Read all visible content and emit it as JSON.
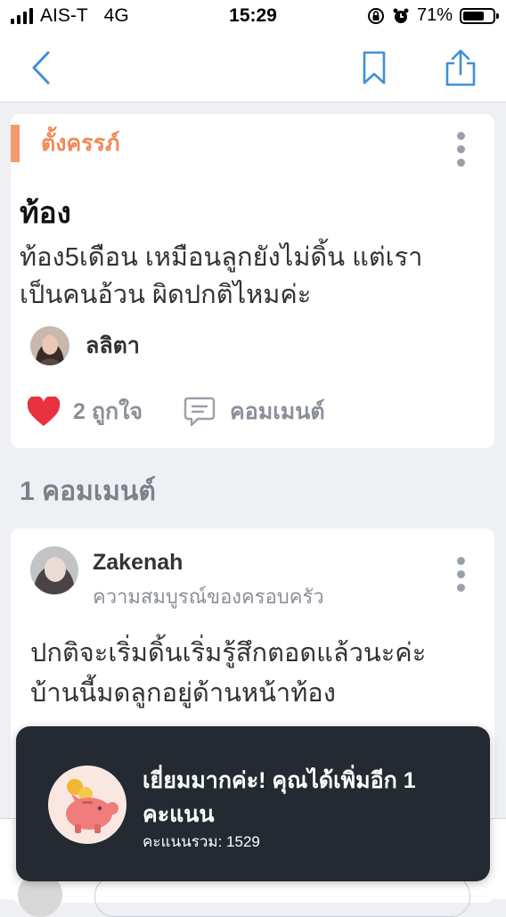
{
  "status_bar": {
    "carrier": "AIS-T",
    "network": "4G",
    "time": "15:29",
    "battery_label": "71%",
    "battery_level": 0.71
  },
  "nav": {
    "back_icon": "chevron-left-icon",
    "bookmark_icon": "bookmark-icon",
    "share_icon": "share-icon",
    "accent_color": "#3d8fd9"
  },
  "post": {
    "tag": "ตั้งครรภ์",
    "title": "ท้อง",
    "body": "ท้อง5เดือน เหมือนลูกยังไม่ดิ้น แต่เราเป็นคนอ้วน ผิดปกติไหมค่ะ",
    "author": "ลลิตา",
    "likes_label": "2 ถูกใจ",
    "comment_label": "คอมเมนต์",
    "tag_color": "#ef8a58",
    "like_color": "#e8323f"
  },
  "comments_heading": "1 คอมเมนต์",
  "comment": {
    "author": "Zakenah",
    "subtitle": "ความสมบูรณ์ของครอบครัว",
    "body": "ปกติจะเริ่มดิ้นเริ่มรู้สึกตอดแล้วนะค่ะ บ้านนี้มดลูกอยู่ด้านหน้าท้อง"
  },
  "toast": {
    "title": "เยี่ยมมากค่ะ! คุณได้เพิ่มอีก 1 คะแนน",
    "subtitle": "คะแนนรวม: 1529",
    "icon": "piggy-bank-icon"
  }
}
